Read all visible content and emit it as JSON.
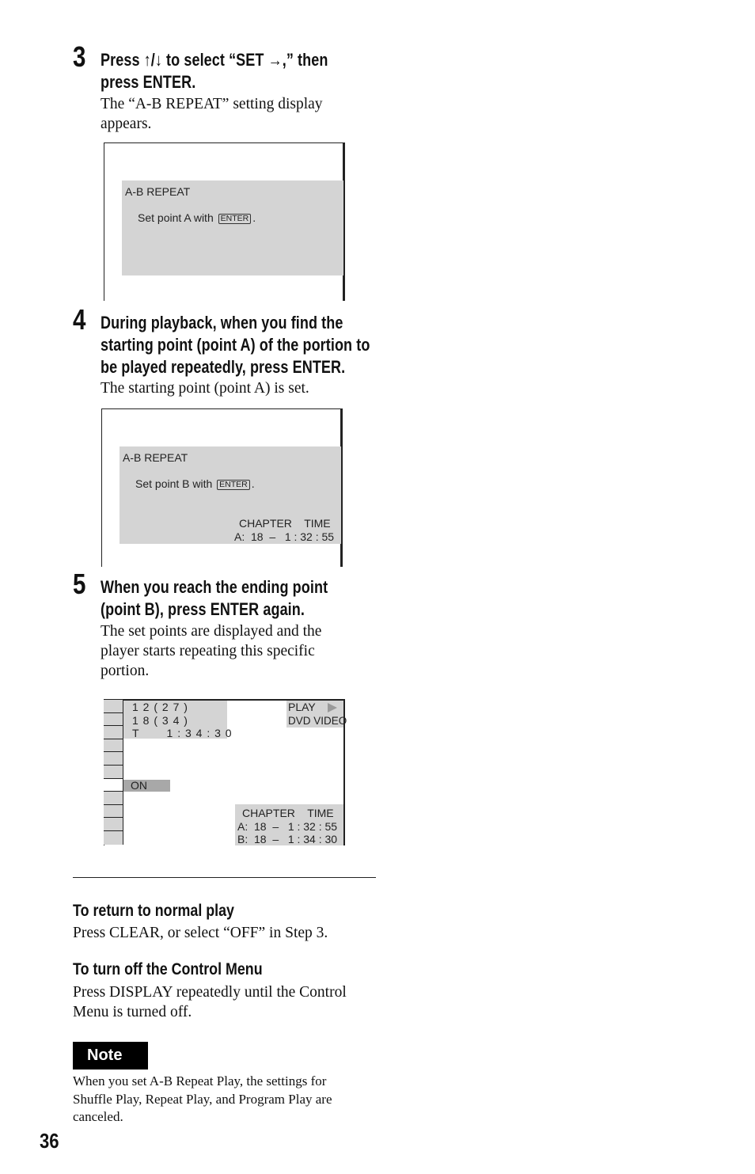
{
  "steps": [
    {
      "number": "3",
      "heading_lines": [
        "Press ↑/↓ to select “SET →,” then",
        "press ENTER."
      ],
      "body_lines": [
        "The “A-B REPEAT” setting display",
        "appears."
      ],
      "display": {
        "title": "A-B REPEAT",
        "prompt_prefix": "Set point A with",
        "key_label": "ENTER",
        "prompt_suffix": "."
      }
    },
    {
      "number": "4",
      "heading_lines": [
        "During playback, when you find the",
        "starting point (point A) of the portion to",
        "be played repeatedly, press ENTER."
      ],
      "body_lines": [
        "The starting point (point A) is set."
      ],
      "display": {
        "title": "A-B REPEAT",
        "prompt_prefix": "Set point B with",
        "key_label": "ENTER",
        "prompt_suffix": ".",
        "columns_header": "CHAPTER    TIME",
        "point_a": "A:  18  –   1 : 32 : 55"
      }
    },
    {
      "number": "5",
      "heading_lines": [
        "When you reach the ending point",
        "(point B), press ENTER again."
      ],
      "body_lines": [
        "The set points are displayed and the",
        "player starts repeating this specific",
        "portion."
      ],
      "display": {
        "info_lines": [
          "1 2 ( 2 7 )",
          "1 8 ( 3 4 )",
          "T       1 : 3 4 : 3 0"
        ],
        "status_play": "PLAY",
        "status_play_icon": "play-triangle",
        "disc_type": "DVD VIDEO",
        "setting_value": "ON",
        "control_menu_items": 11,
        "selected_item_index": 7,
        "columns_header": "CHAPTER    TIME",
        "point_a": "A:  18  –   1 : 32 : 55",
        "point_b": "B:  18  –   1 : 34 : 30"
      }
    }
  ],
  "sections": [
    {
      "heading": "To return to normal play",
      "body_lines": [
        "Press CLEAR, or select “OFF” in Step 3."
      ]
    },
    {
      "heading": "To turn off the Control Menu",
      "body_lines": [
        "Press DISPLAY repeatedly until the Control",
        "Menu is turned off."
      ]
    }
  ],
  "note": {
    "label": "Note",
    "lines": [
      "When you set A-B Repeat Play, the settings for",
      "Shuffle Play, Repeat Play, and Program Play are",
      "canceled."
    ]
  },
  "page_number": "36",
  "colors": {
    "osd_panel": "#d4d4d4",
    "osd_highlight": "#a8a8a8",
    "note_badge": "#000000"
  }
}
